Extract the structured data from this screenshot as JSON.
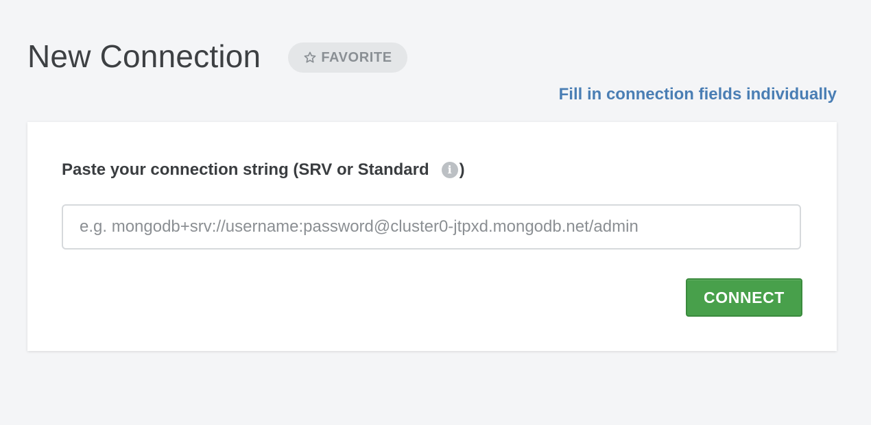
{
  "header": {
    "title": "New Connection",
    "favorite_label": "FAVORITE"
  },
  "links": {
    "fill_individually": "Fill in connection fields individually"
  },
  "form": {
    "label_prefix": "Paste your connection string (SRV or Standard",
    "label_suffix": ")",
    "info_glyph": "i",
    "input_value": "",
    "input_placeholder": "e.g. mongodb+srv://username:password@cluster0-jtpxd.mongodb.net/admin",
    "connect_label": "CONNECT"
  },
  "colors": {
    "background": "#f4f5f7",
    "link": "#4a7eb4",
    "connect_button": "#48a04b",
    "favorite_pill": "#e4e6e8"
  },
  "icons": {
    "favorite": "star-outline-icon",
    "info": "info-icon"
  }
}
